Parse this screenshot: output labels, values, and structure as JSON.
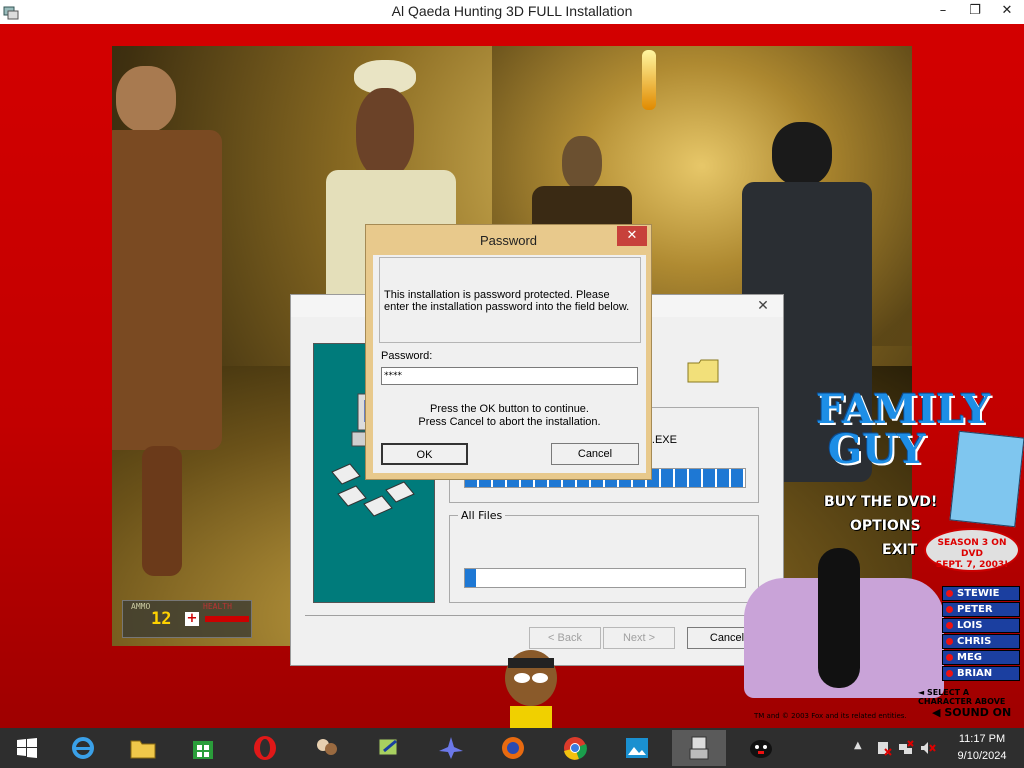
{
  "window": {
    "title": "Al Qaeda Hunting 3D FULL Installation",
    "minimize": "–",
    "restore": "❐",
    "close": "✕"
  },
  "hud": {
    "ammo_label": "AMMO",
    "ammo_count": "12",
    "health_label": "HEALTH",
    "health_icon": "+"
  },
  "setup_dialog": {
    "close": "✕",
    "file_label": "GE.EXE",
    "file_progress": 1.0,
    "all_files_label": "All Files",
    "all_files_progress": 0.04,
    "back_button": "< Back",
    "next_button": "Next >",
    "cancel_button": "Cancel"
  },
  "password_dialog": {
    "title": "Password",
    "close": "✕",
    "message": "This installation is password protected. Please enter the installation password into the field below.",
    "password_label": "Password:",
    "password_value": "****",
    "hint_line1": "Press the OK button to continue.",
    "hint_line2": "Press Cancel to abort the installation.",
    "ok_button": "OK",
    "cancel_button": "Cancel"
  },
  "ad": {
    "logo_line1": "FAMILY",
    "logo_line2": "GUY",
    "menu": [
      "BUY THE DVD!",
      "OPTIONS",
      "EXIT"
    ],
    "promo_line1": "SEASON 3 ON DVD",
    "promo_line2": "SEPT. 7, 2003!",
    "characters": [
      "STEWIE",
      "PETER",
      "LOIS",
      "CHRIS",
      "MEG",
      "BRIAN"
    ],
    "select_text": "◄ SELECT A CHARACTER ABOVE",
    "copyright": "TM and © 2003 Fox and its related entities.",
    "sound": "SOUND ON"
  },
  "taskbar": {
    "icons": [
      "start-icon",
      "internet-explorer-icon",
      "file-explorer-icon",
      "store-icon",
      "opera-icon",
      "game-icon",
      "setup-icon",
      "jet-icon",
      "firefox-icon",
      "chrome-icon",
      "photos-icon",
      "installer-icon",
      "penguin-icon"
    ],
    "tray_arrow": "▲",
    "time": "11:17 PM",
    "date": "9/10/2024"
  },
  "colors": {
    "accent_blue": "#1e78d4",
    "desktop_red": "#d40000",
    "dialog_frame": "#e8c98c",
    "teal": "#007b7b"
  }
}
